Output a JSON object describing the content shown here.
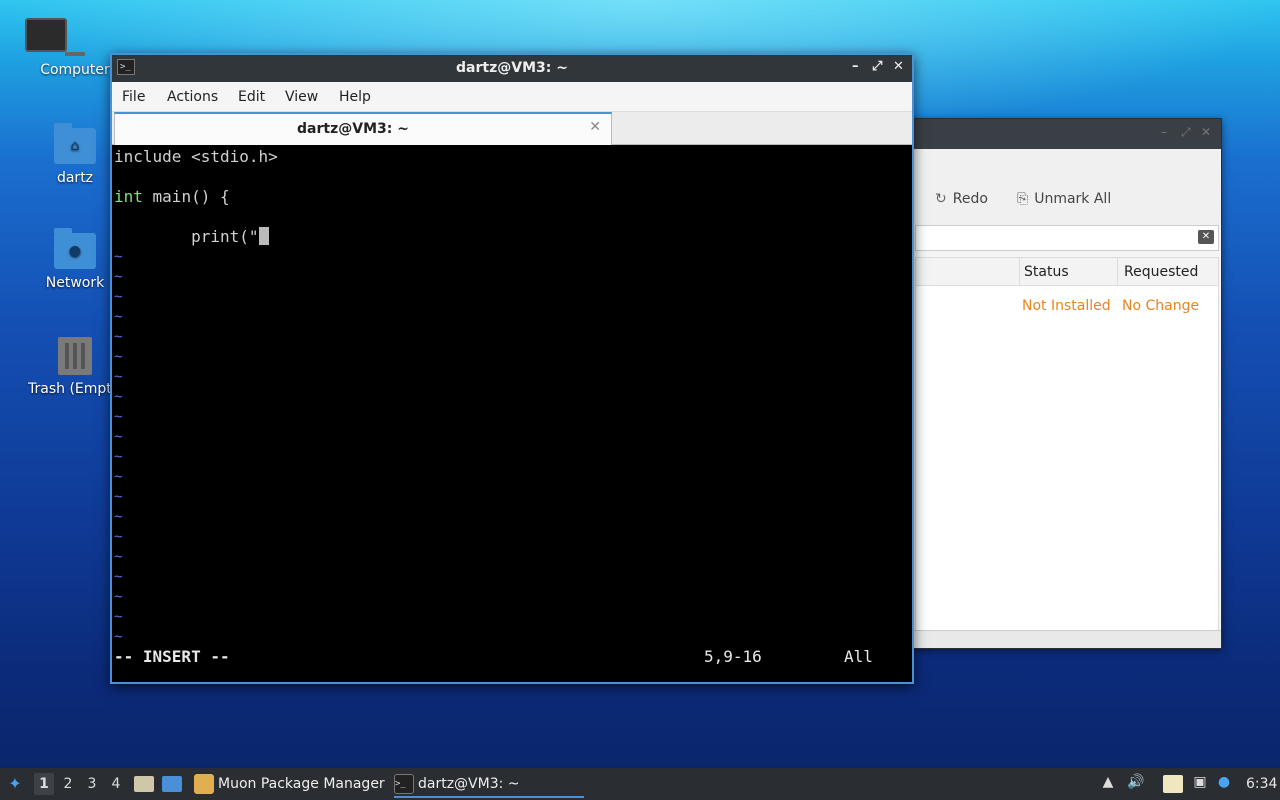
{
  "desktop": {
    "icons": [
      {
        "label": "Computer"
      },
      {
        "label": "dartz"
      },
      {
        "label": "Network"
      },
      {
        "label": "Trash (Empty)"
      }
    ]
  },
  "muon": {
    "toolbar": {
      "redo": "Redo",
      "unmark_all": "Unmark All"
    },
    "columns": [
      "Status",
      "Requested"
    ],
    "row": {
      "status": "Not Installed",
      "requested": "No Change"
    },
    "status_color": "#e8851a"
  },
  "terminal": {
    "title": "dartz@VM3: ~",
    "menu": [
      "File",
      "Actions",
      "Edit",
      "View",
      "Help"
    ],
    "tab_label": "dartz@VM3: ~",
    "lines": {
      "l1": "include <stdio.h>",
      "l3_kw": "int",
      "l3_rest": " main() {",
      "l5": "        print(\""
    },
    "tilde": "~",
    "mode": "-- INSERT --",
    "position": "5,9-16",
    "scroll": "All",
    "accent": "#4a90d9"
  },
  "taskbar": {
    "workspaces": [
      "1",
      "2",
      "3",
      "4"
    ],
    "tasks": [
      {
        "label": "Muon Package Manager",
        "icon": "package-icon"
      },
      {
        "label": "dartz@VM3: ~",
        "icon": "terminal-icon"
      }
    ],
    "clock": "6:34"
  }
}
